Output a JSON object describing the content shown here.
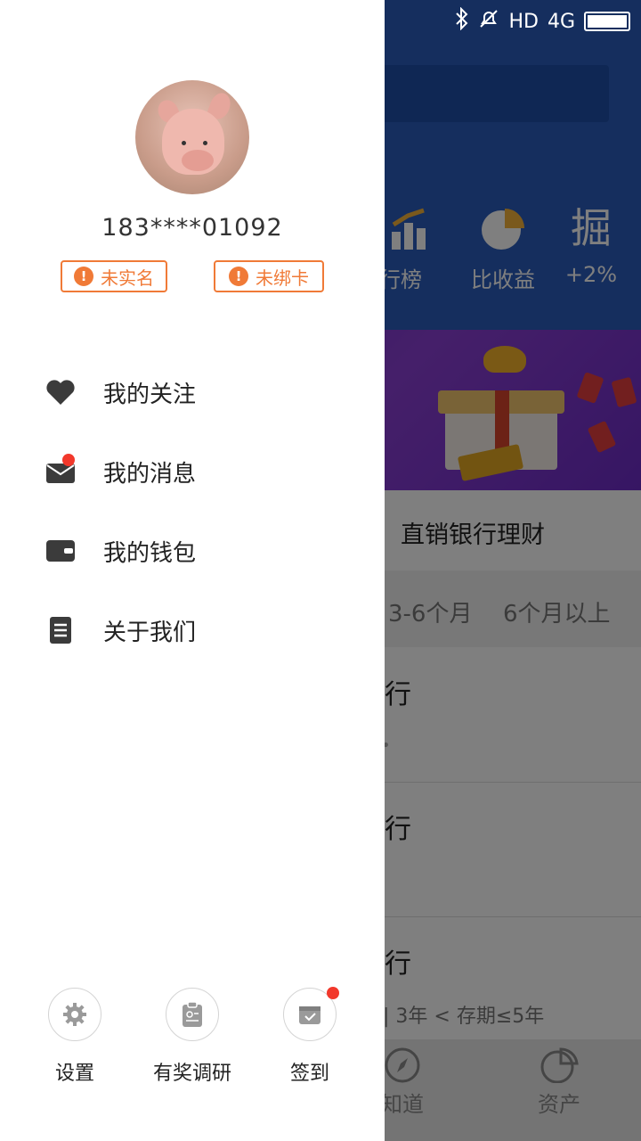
{
  "status_bar": {
    "hd": "HD",
    "network": "4G"
  },
  "background": {
    "categories": [
      {
        "label": "行榜",
        "icon": "bar-chart-icon"
      },
      {
        "label": "比收益",
        "icon": "pie-chart-icon"
      },
      {
        "label": "+2%",
        "icon": "juejin-icon",
        "glyph": "掘"
      }
    ],
    "section_title": "直销银行理财",
    "filters": [
      "3-6个月",
      "6个月以上"
    ],
    "rows": [
      "行",
      "行",
      "行"
    ],
    "row_sub": "| 3年 < 存期≤5年",
    "row_sub_small": "•",
    "tabs": [
      {
        "label": "知道",
        "icon": "compass-icon"
      },
      {
        "label": "资产",
        "icon": "pie-chart-icon"
      }
    ]
  },
  "drawer": {
    "phone": "183****01092",
    "badges": [
      {
        "label": "未实名",
        "icon": "warning-icon"
      },
      {
        "label": "未绑卡",
        "icon": "warning-icon"
      }
    ],
    "menu": [
      {
        "label": "我的关注",
        "icon": "heart-icon"
      },
      {
        "label": "我的消息",
        "icon": "mail-icon",
        "badge_dot": true
      },
      {
        "label": "我的钱包",
        "icon": "wallet-icon"
      },
      {
        "label": "关于我们",
        "icon": "document-icon"
      }
    ],
    "bottom": [
      {
        "label": "设置",
        "icon": "gear-icon"
      },
      {
        "label": "有奖调研",
        "icon": "clipboard-icon"
      },
      {
        "label": "签到",
        "icon": "calendar-check-icon",
        "badge_dot": true
      }
    ],
    "accent_color": "#f07a37",
    "dot_color": "#f2382b"
  }
}
